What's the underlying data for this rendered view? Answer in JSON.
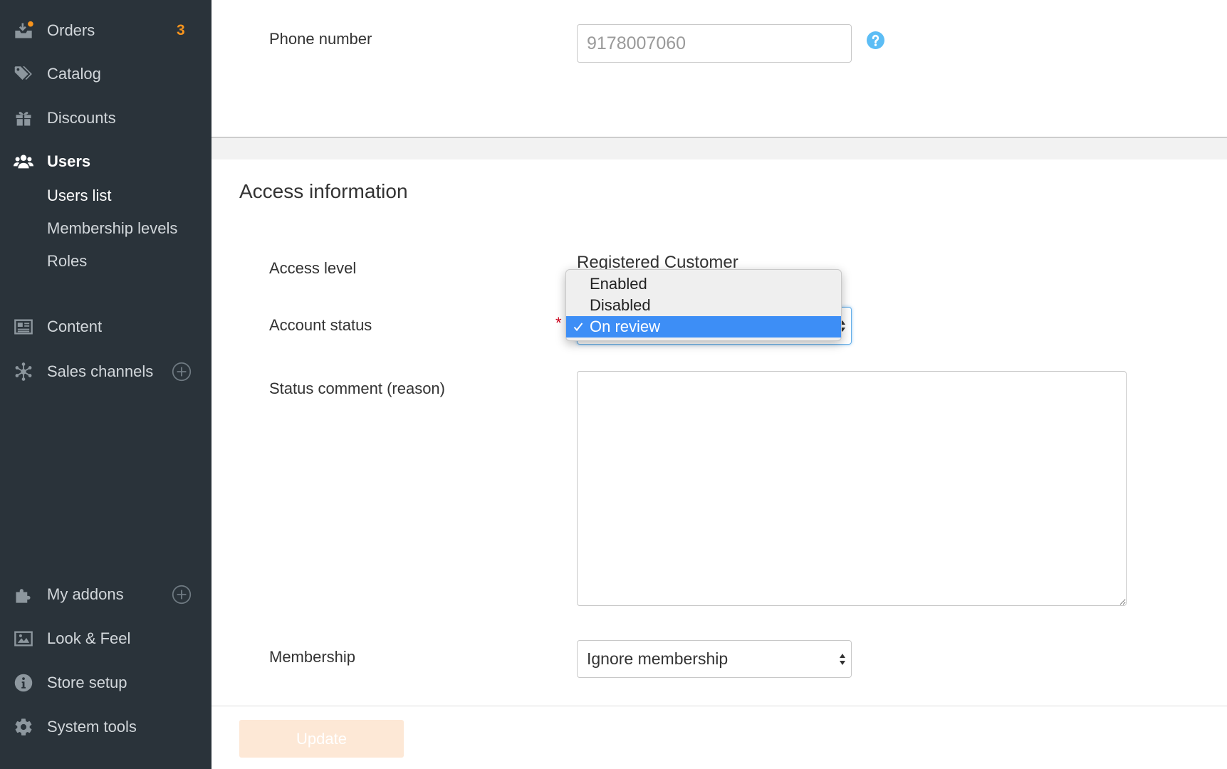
{
  "colors": {
    "sidebar_background": "#2a333a",
    "accent_orange": "#f7941d",
    "selection_blue": "#3d8ef6",
    "help_icon_blue": "#5cbdf5",
    "focus_blue": "#66afe9",
    "required_red": "#d0021b",
    "update_button_background": "#fde8d6"
  },
  "sidebar": {
    "items": [
      {
        "label": "Orders",
        "icon": "orders-icon",
        "badge": "3"
      },
      {
        "label": "Catalog",
        "icon": "tags-icon"
      },
      {
        "label": "Discounts",
        "icon": "gift-icon"
      },
      {
        "label": "Users",
        "icon": "users-icon",
        "active": true
      },
      {
        "label": "Content",
        "icon": "newspaper-icon"
      },
      {
        "label": "Sales channels",
        "icon": "network-icon",
        "action_icon": "plus-circle-icon"
      },
      {
        "label": "My addons",
        "icon": "puzzle-icon",
        "action_icon": "plus-circle-icon"
      },
      {
        "label": "Look & Feel",
        "icon": "image-icon"
      },
      {
        "label": "Store setup",
        "icon": "info-icon"
      },
      {
        "label": "System tools",
        "icon": "gear-icon"
      }
    ],
    "users_submenu": [
      {
        "label": "Users list",
        "active": true
      },
      {
        "label": "Membership levels"
      },
      {
        "label": "Roles"
      }
    ]
  },
  "contact": {
    "phone_label": "Phone number",
    "phone_value": "9178007060",
    "help_icon": "question-circle-icon"
  },
  "access": {
    "heading": "Access information",
    "access_level_label": "Access level",
    "access_level_value": "Registered Customer",
    "account_status_label": "Account status",
    "required_mark": "*",
    "account_status_options": [
      {
        "label": "Enabled",
        "selected": false
      },
      {
        "label": "Disabled",
        "selected": false
      },
      {
        "label": "On review",
        "selected": true
      }
    ],
    "status_comment_label": "Status comment (reason)",
    "membership_label": "Membership",
    "membership_value": "Ignore membership"
  },
  "actions": {
    "update_label": "Update",
    "update_disabled": true
  }
}
